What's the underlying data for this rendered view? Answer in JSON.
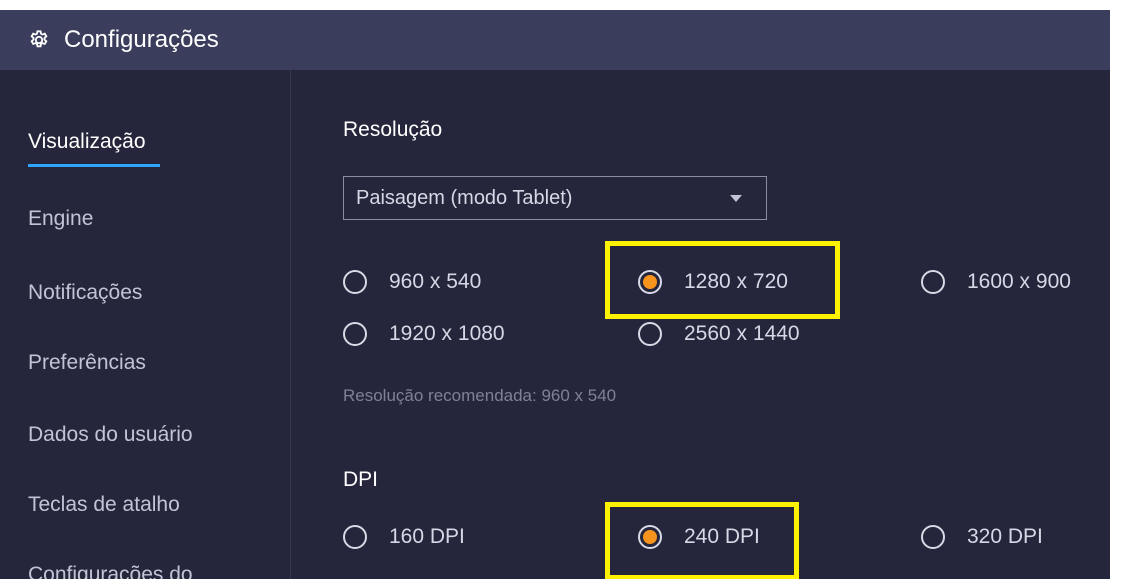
{
  "header_strip_text": "Configurações                    Configurações                    Configurações",
  "window": {
    "title": "Configurações",
    "title_icon": "gear-icon"
  },
  "sidebar": {
    "items": [
      {
        "label": "Visualização",
        "active": true
      },
      {
        "label": "Engine",
        "active": false
      },
      {
        "label": "Notificações",
        "active": false
      },
      {
        "label": "Preferências",
        "active": false
      },
      {
        "label": "Dados do usuário",
        "active": false
      },
      {
        "label": "Teclas de atalho",
        "active": false
      },
      {
        "label": "Configurações do",
        "active": false
      }
    ]
  },
  "resolution": {
    "title": "Resolução",
    "dropdown_value": "Paisagem (modo Tablet)",
    "options": [
      {
        "label": "960 x 540",
        "checked": false
      },
      {
        "label": "1280 x 720",
        "checked": true
      },
      {
        "label": "1600 x 900",
        "checked": false
      },
      {
        "label": "1920 x 1080",
        "checked": false
      },
      {
        "label": "2560 x 1440",
        "checked": false
      }
    ],
    "hint": "Resolução recomendada: 960 x 540"
  },
  "dpi": {
    "title": "DPI",
    "options": [
      {
        "label": "160 DPI",
        "checked": false
      },
      {
        "label": "240 DPI",
        "checked": true
      },
      {
        "label": "320 DPI",
        "checked": false
      }
    ]
  },
  "colors": {
    "title_bar": "#3a3d5c",
    "background": "#25263b",
    "accent_underline": "#2ea5ff",
    "radio_selected": "#f7941d",
    "highlight": "#fff200"
  }
}
